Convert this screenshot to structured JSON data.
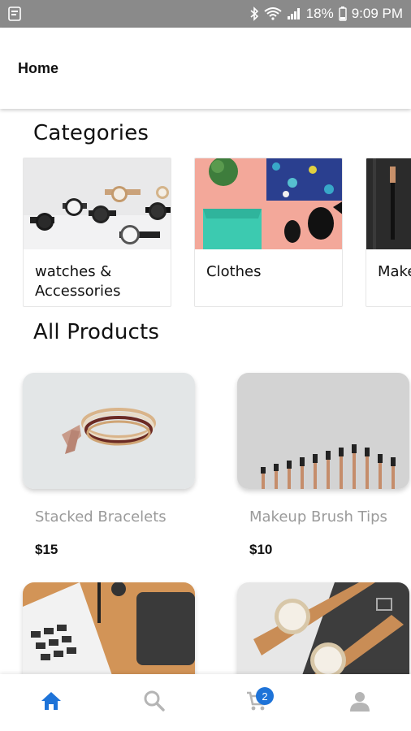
{
  "status_bar": {
    "battery": "18%",
    "time": "9:09 PM",
    "icons": [
      "notification-icon",
      "bluetooth-icon",
      "wifi-icon",
      "signal-icon",
      "battery-icon"
    ]
  },
  "app_bar": {
    "title": "Home"
  },
  "categories": {
    "title": "Categories",
    "items": [
      {
        "label": "watches & Accessories"
      },
      {
        "label": "Clothes"
      },
      {
        "label": "Make"
      }
    ]
  },
  "all_products": {
    "title": "All Products",
    "items": [
      {
        "name": "Stacked Bracelets",
        "price": "$15"
      },
      {
        "name": "Makeup Brush Tips",
        "price": "$10"
      },
      {
        "name": "",
        "price": ""
      },
      {
        "name": "",
        "price": ""
      }
    ]
  },
  "bottom_nav": {
    "items": [
      "home-icon",
      "search-icon",
      "cart-icon",
      "profile-icon"
    ],
    "active": "home",
    "cart_badge": "2",
    "colors": {
      "active": "#1e73d8",
      "inactive": "#b5b5b5"
    }
  }
}
